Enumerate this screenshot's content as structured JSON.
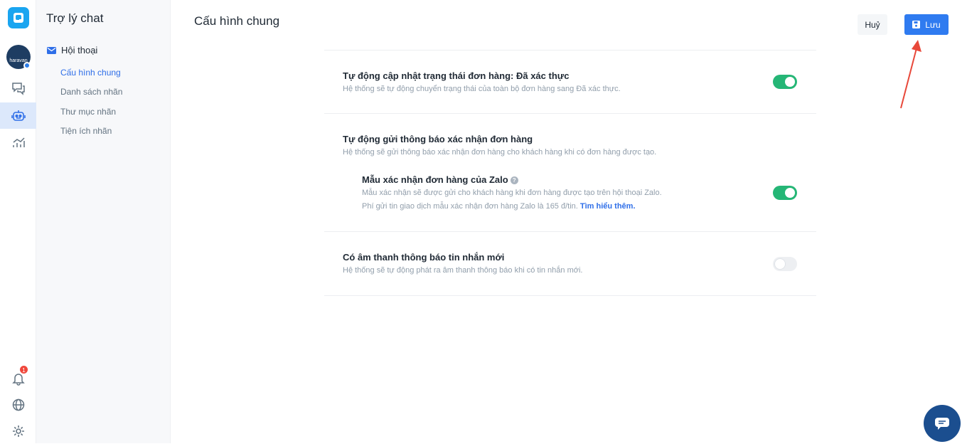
{
  "app": {
    "title": "Trợ lý chat"
  },
  "rail": {
    "logo_icon": "app-logo-icon",
    "avatar_text": "haravan",
    "notification_count": "1",
    "items": [
      "chat-icon",
      "bot-icon",
      "analytics-icon",
      "bell-icon",
      "globe-icon",
      "gear-icon"
    ]
  },
  "subnav": {
    "group_label": "Hội thoại",
    "items": [
      {
        "label": "Cấu hình chung",
        "active": true
      },
      {
        "label": "Danh sách nhãn",
        "active": false
      },
      {
        "label": "Thư mục nhãn",
        "active": false
      },
      {
        "label": "Tiện ích nhãn",
        "active": false
      }
    ]
  },
  "header": {
    "title": "Cấu hình chung",
    "cancel_label": "Huỷ",
    "save_label": "Lưu"
  },
  "settings": [
    {
      "title": "Tự động cập nhật trạng thái đơn hàng: Đã xác thực",
      "description": "Hệ thống sẽ tự động chuyển trạng thái của toàn bộ đơn hàng sang Đã xác thực.",
      "enabled": true
    },
    {
      "title": "Tự động gửi thông báo xác nhận đơn hàng",
      "description": "Hệ thống sẽ gửi thông báo xác nhận đơn hàng cho khách hàng khi có đơn hàng được tạo.",
      "sub": {
        "title": "Mẫu xác nhận đơn hàng của Zalo",
        "help_glyph": "?",
        "description_line1": "Mẫu xác nhận sẽ được gửi cho khách hàng khi đơn hàng được tạo trên hội thoại Zalo.",
        "description_line2": "Phí gửi tin giao dịch mẫu xác nhận đơn hàng Zalo là 165 đ/tin.",
        "link_label": "Tìm hiểu thêm.",
        "enabled": true
      }
    },
    {
      "title": "Có âm thanh thông báo tin nhắn mới",
      "description": "Hệ thống sẽ tự động phát ra âm thanh thông báo khi có tin nhắn mới.",
      "enabled": false
    }
  ],
  "colors": {
    "accent": "#2f7bf0",
    "toggle_on": "#25b676",
    "annotation_arrow": "#e8483a"
  }
}
